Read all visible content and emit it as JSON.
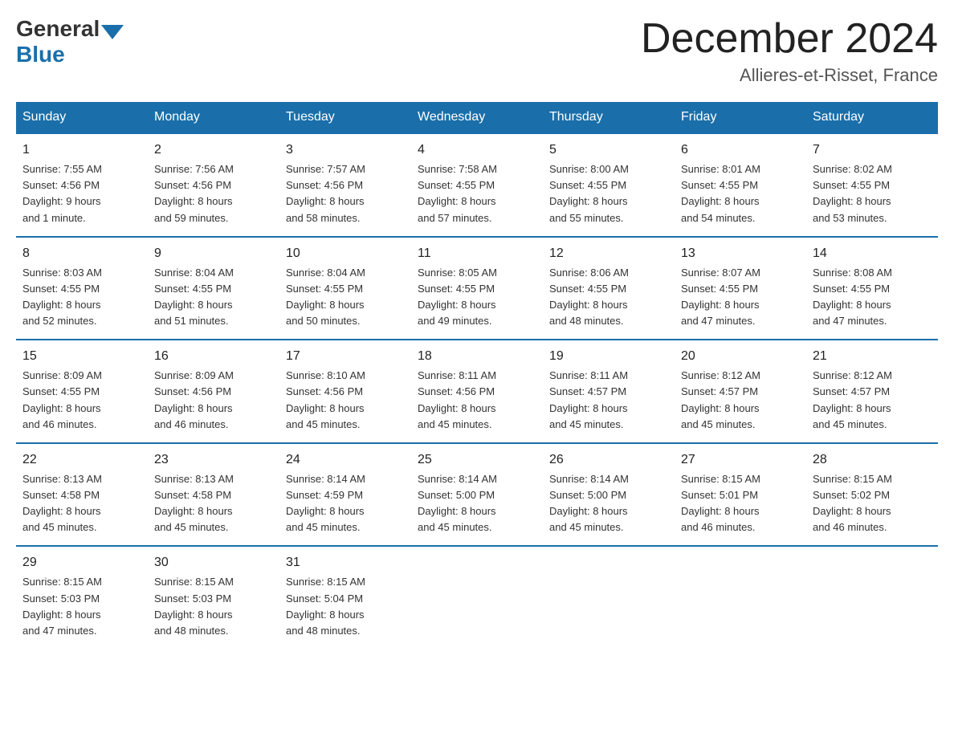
{
  "logo": {
    "general": "General",
    "blue": "Blue"
  },
  "title": {
    "month_year": "December 2024",
    "location": "Allieres-et-Risset, France"
  },
  "weekdays": [
    "Sunday",
    "Monday",
    "Tuesday",
    "Wednesday",
    "Thursday",
    "Friday",
    "Saturday"
  ],
  "weeks": [
    [
      {
        "day": "1",
        "info": "Sunrise: 7:55 AM\nSunset: 4:56 PM\nDaylight: 9 hours\nand 1 minute."
      },
      {
        "day": "2",
        "info": "Sunrise: 7:56 AM\nSunset: 4:56 PM\nDaylight: 8 hours\nand 59 minutes."
      },
      {
        "day": "3",
        "info": "Sunrise: 7:57 AM\nSunset: 4:56 PM\nDaylight: 8 hours\nand 58 minutes."
      },
      {
        "day": "4",
        "info": "Sunrise: 7:58 AM\nSunset: 4:55 PM\nDaylight: 8 hours\nand 57 minutes."
      },
      {
        "day": "5",
        "info": "Sunrise: 8:00 AM\nSunset: 4:55 PM\nDaylight: 8 hours\nand 55 minutes."
      },
      {
        "day": "6",
        "info": "Sunrise: 8:01 AM\nSunset: 4:55 PM\nDaylight: 8 hours\nand 54 minutes."
      },
      {
        "day": "7",
        "info": "Sunrise: 8:02 AM\nSunset: 4:55 PM\nDaylight: 8 hours\nand 53 minutes."
      }
    ],
    [
      {
        "day": "8",
        "info": "Sunrise: 8:03 AM\nSunset: 4:55 PM\nDaylight: 8 hours\nand 52 minutes."
      },
      {
        "day": "9",
        "info": "Sunrise: 8:04 AM\nSunset: 4:55 PM\nDaylight: 8 hours\nand 51 minutes."
      },
      {
        "day": "10",
        "info": "Sunrise: 8:04 AM\nSunset: 4:55 PM\nDaylight: 8 hours\nand 50 minutes."
      },
      {
        "day": "11",
        "info": "Sunrise: 8:05 AM\nSunset: 4:55 PM\nDaylight: 8 hours\nand 49 minutes."
      },
      {
        "day": "12",
        "info": "Sunrise: 8:06 AM\nSunset: 4:55 PM\nDaylight: 8 hours\nand 48 minutes."
      },
      {
        "day": "13",
        "info": "Sunrise: 8:07 AM\nSunset: 4:55 PM\nDaylight: 8 hours\nand 47 minutes."
      },
      {
        "day": "14",
        "info": "Sunrise: 8:08 AM\nSunset: 4:55 PM\nDaylight: 8 hours\nand 47 minutes."
      }
    ],
    [
      {
        "day": "15",
        "info": "Sunrise: 8:09 AM\nSunset: 4:55 PM\nDaylight: 8 hours\nand 46 minutes."
      },
      {
        "day": "16",
        "info": "Sunrise: 8:09 AM\nSunset: 4:56 PM\nDaylight: 8 hours\nand 46 minutes."
      },
      {
        "day": "17",
        "info": "Sunrise: 8:10 AM\nSunset: 4:56 PM\nDaylight: 8 hours\nand 45 minutes."
      },
      {
        "day": "18",
        "info": "Sunrise: 8:11 AM\nSunset: 4:56 PM\nDaylight: 8 hours\nand 45 minutes."
      },
      {
        "day": "19",
        "info": "Sunrise: 8:11 AM\nSunset: 4:57 PM\nDaylight: 8 hours\nand 45 minutes."
      },
      {
        "day": "20",
        "info": "Sunrise: 8:12 AM\nSunset: 4:57 PM\nDaylight: 8 hours\nand 45 minutes."
      },
      {
        "day": "21",
        "info": "Sunrise: 8:12 AM\nSunset: 4:57 PM\nDaylight: 8 hours\nand 45 minutes."
      }
    ],
    [
      {
        "day": "22",
        "info": "Sunrise: 8:13 AM\nSunset: 4:58 PM\nDaylight: 8 hours\nand 45 minutes."
      },
      {
        "day": "23",
        "info": "Sunrise: 8:13 AM\nSunset: 4:58 PM\nDaylight: 8 hours\nand 45 minutes."
      },
      {
        "day": "24",
        "info": "Sunrise: 8:14 AM\nSunset: 4:59 PM\nDaylight: 8 hours\nand 45 minutes."
      },
      {
        "day": "25",
        "info": "Sunrise: 8:14 AM\nSunset: 5:00 PM\nDaylight: 8 hours\nand 45 minutes."
      },
      {
        "day": "26",
        "info": "Sunrise: 8:14 AM\nSunset: 5:00 PM\nDaylight: 8 hours\nand 45 minutes."
      },
      {
        "day": "27",
        "info": "Sunrise: 8:15 AM\nSunset: 5:01 PM\nDaylight: 8 hours\nand 46 minutes."
      },
      {
        "day": "28",
        "info": "Sunrise: 8:15 AM\nSunset: 5:02 PM\nDaylight: 8 hours\nand 46 minutes."
      }
    ],
    [
      {
        "day": "29",
        "info": "Sunrise: 8:15 AM\nSunset: 5:03 PM\nDaylight: 8 hours\nand 47 minutes."
      },
      {
        "day": "30",
        "info": "Sunrise: 8:15 AM\nSunset: 5:03 PM\nDaylight: 8 hours\nand 48 minutes."
      },
      {
        "day": "31",
        "info": "Sunrise: 8:15 AM\nSunset: 5:04 PM\nDaylight: 8 hours\nand 48 minutes."
      },
      {
        "day": "",
        "info": ""
      },
      {
        "day": "",
        "info": ""
      },
      {
        "day": "",
        "info": ""
      },
      {
        "day": "",
        "info": ""
      }
    ]
  ]
}
